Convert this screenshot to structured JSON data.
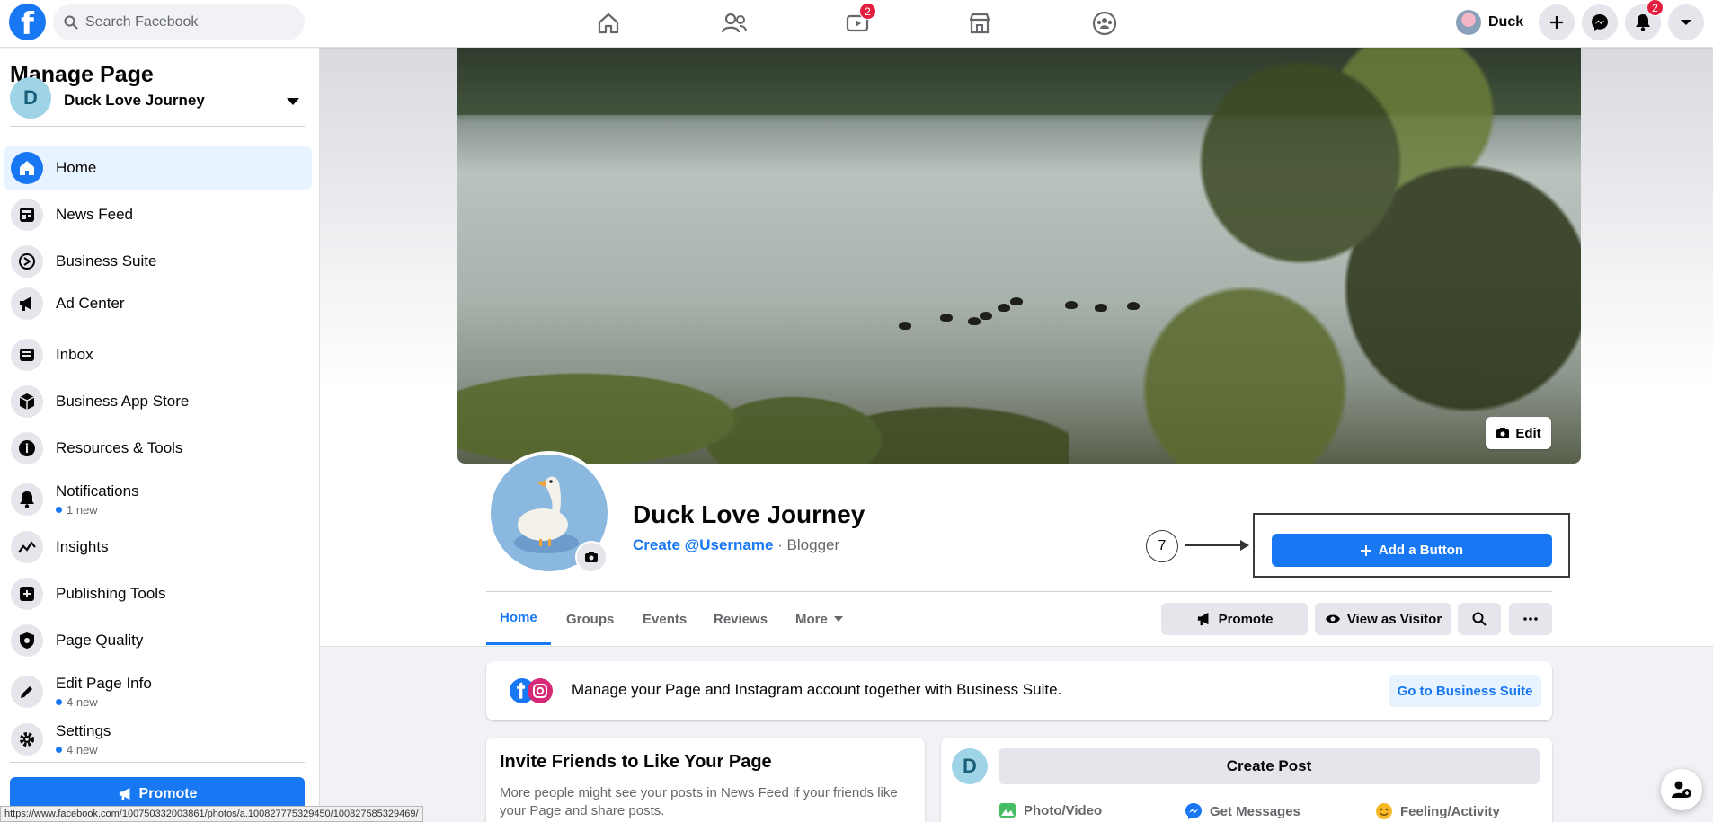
{
  "topbar": {
    "logo": "f",
    "search_placeholder": "Search Facebook",
    "watch_badge": "2",
    "profile_name": "Duck",
    "notifications_badge": "2"
  },
  "sidebar": {
    "title": "Manage Page",
    "page_name": "Duck Love Journey",
    "page_initial": "D",
    "items": [
      {
        "label": "Home",
        "icon": "home-icon"
      },
      {
        "label": "News Feed",
        "icon": "news-feed-icon"
      },
      {
        "label": "Business Suite",
        "icon": "business-suite-icon"
      },
      {
        "label": "Ad Center",
        "icon": "megaphone-icon"
      },
      {
        "label": "Inbox",
        "icon": "inbox-icon"
      },
      {
        "label": "Business App Store",
        "icon": "cube-icon"
      },
      {
        "label": "Resources & Tools",
        "icon": "info-icon"
      },
      {
        "label": "Notifications",
        "sub": "1 new",
        "icon": "bell-icon"
      },
      {
        "label": "Insights",
        "icon": "insights-icon"
      },
      {
        "label": "Publishing Tools",
        "icon": "publishing-icon"
      },
      {
        "label": "Page Quality",
        "icon": "shield-icon"
      },
      {
        "label": "Edit Page Info",
        "sub": "4 new",
        "icon": "pencil-icon"
      },
      {
        "label": "Settings",
        "sub": "4 new",
        "icon": "gear-icon"
      }
    ],
    "promote_label": "Promote"
  },
  "status_url": "https://www.facebook.com/100750332003861/photos/a.100827775329450/100827585329469/",
  "cover": {
    "edit_label": "Edit"
  },
  "page": {
    "name": "Duck Love Journey",
    "username_link": "Create @Username",
    "separator": " · ",
    "category": "Blogger"
  },
  "annotation": {
    "step": "7"
  },
  "add_button_label": "Add a Button",
  "tabs": [
    "Home",
    "Groups",
    "Events",
    "Reviews",
    "More"
  ],
  "actions": {
    "promote": "Promote",
    "view_as_visitor": "View as Visitor"
  },
  "business_suite_card": {
    "text": "Manage your Page and Instagram account together with Business Suite.",
    "button": "Go to Business Suite"
  },
  "invite_card": {
    "title": "Invite Friends to Like Your Page",
    "body": "More people might see your posts in News Feed if your friends like your Page and share posts."
  },
  "post_card": {
    "initial": "D",
    "create_label": "Create Post",
    "actions": [
      "Photo/Video",
      "Get Messages",
      "Feeling/Activity"
    ]
  },
  "colors": {
    "brand": "#1877f2",
    "badge": "#e41e3f",
    "background": "#f0f2f5"
  }
}
